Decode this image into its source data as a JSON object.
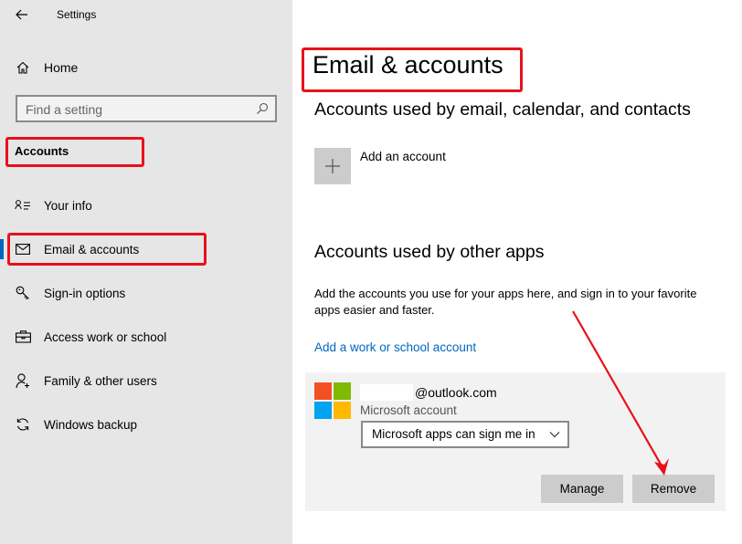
{
  "window": {
    "title": "Settings"
  },
  "sidebar": {
    "home_label": "Home",
    "search_placeholder": "Find a setting",
    "section_title": "Accounts",
    "items": [
      {
        "label": "Your info",
        "icon": "person-card-icon"
      },
      {
        "label": "Email & accounts",
        "icon": "mail-icon",
        "active": true
      },
      {
        "label": "Sign-in options",
        "icon": "key-icon"
      },
      {
        "label": "Access work or school",
        "icon": "briefcase-icon"
      },
      {
        "label": "Family & other users",
        "icon": "person-add-icon"
      },
      {
        "label": "Windows backup",
        "icon": "sync-icon"
      }
    ]
  },
  "main": {
    "page_title": "Email & accounts",
    "section1_title": "Accounts used by email, calendar, and contacts",
    "add_account_label": "Add an account",
    "section2_title": "Accounts used by other apps",
    "section2_description": "Add the accounts you use for your apps here, and sign in to your favorite apps easier and faster.",
    "work_school_link": "Add a work or school account",
    "account": {
      "email_suffix": "@outlook.com",
      "type": "Microsoft account",
      "signin_option": "Microsoft apps can sign me in",
      "manage_label": "Manage",
      "remove_label": "Remove"
    }
  },
  "colors": {
    "accent": "#0067c0",
    "highlight_red": "#e8111a",
    "sidebar_bg": "#e6e6e6",
    "ms_red": "#f25022",
    "ms_green": "#7fba00",
    "ms_blue": "#00a4ef",
    "ms_yellow": "#ffb900"
  }
}
